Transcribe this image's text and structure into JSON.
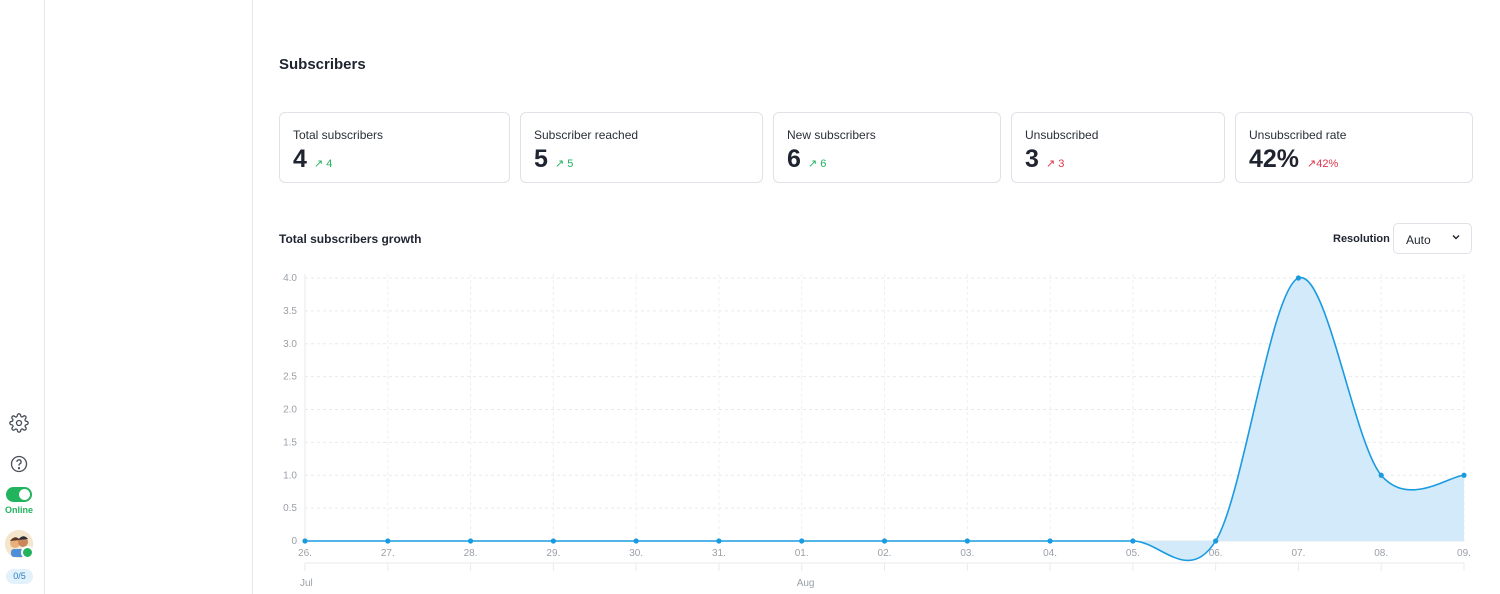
{
  "sidebar": {
    "status_label": "Online",
    "count_badge": "0/5"
  },
  "section_title": "Subscribers",
  "cards": [
    {
      "label": "Total subscribers",
      "value": "4",
      "delta": "4",
      "trend": "up",
      "color": "#22b35e"
    },
    {
      "label": "Subscriber reached",
      "value": "5",
      "delta": "5",
      "trend": "up",
      "color": "#22b35e"
    },
    {
      "label": "New subscribers",
      "value": "6",
      "delta": "6",
      "trend": "up",
      "color": "#22b35e"
    },
    {
      "label": "Unsubscribed",
      "value": "3",
      "delta": "3",
      "trend": "up",
      "color": "#e0354b"
    },
    {
      "label": "Unsubscribed rate",
      "value": "42%",
      "delta": "42%",
      "trend": "up",
      "color": "#e0354b"
    }
  ],
  "chart_title": "Total subscribers growth",
  "resolution": {
    "label": "Resolution",
    "value": "Auto"
  },
  "chart_data": {
    "type": "area",
    "x": [
      "26.",
      "27.",
      "28.",
      "29.",
      "30.",
      "31.",
      "01.",
      "02.",
      "03.",
      "04.",
      "05.",
      "06.",
      "07.",
      "08.",
      "09."
    ],
    "values": [
      0,
      0,
      0,
      0,
      0,
      0,
      0,
      0,
      0,
      0,
      0,
      0,
      4,
      1,
      1
    ],
    "months": [
      {
        "label": "Jul",
        "at": "26."
      },
      {
        "label": "Aug",
        "at": "01."
      }
    ],
    "yticks": [
      "0",
      "0.5",
      "1.0",
      "1.5",
      "2.0",
      "2.5",
      "3.0",
      "3.5",
      "4.0"
    ],
    "ylim": [
      0,
      4
    ],
    "grid": true,
    "line_color": "#1a9be0",
    "fill_color": "#cde8f8"
  }
}
